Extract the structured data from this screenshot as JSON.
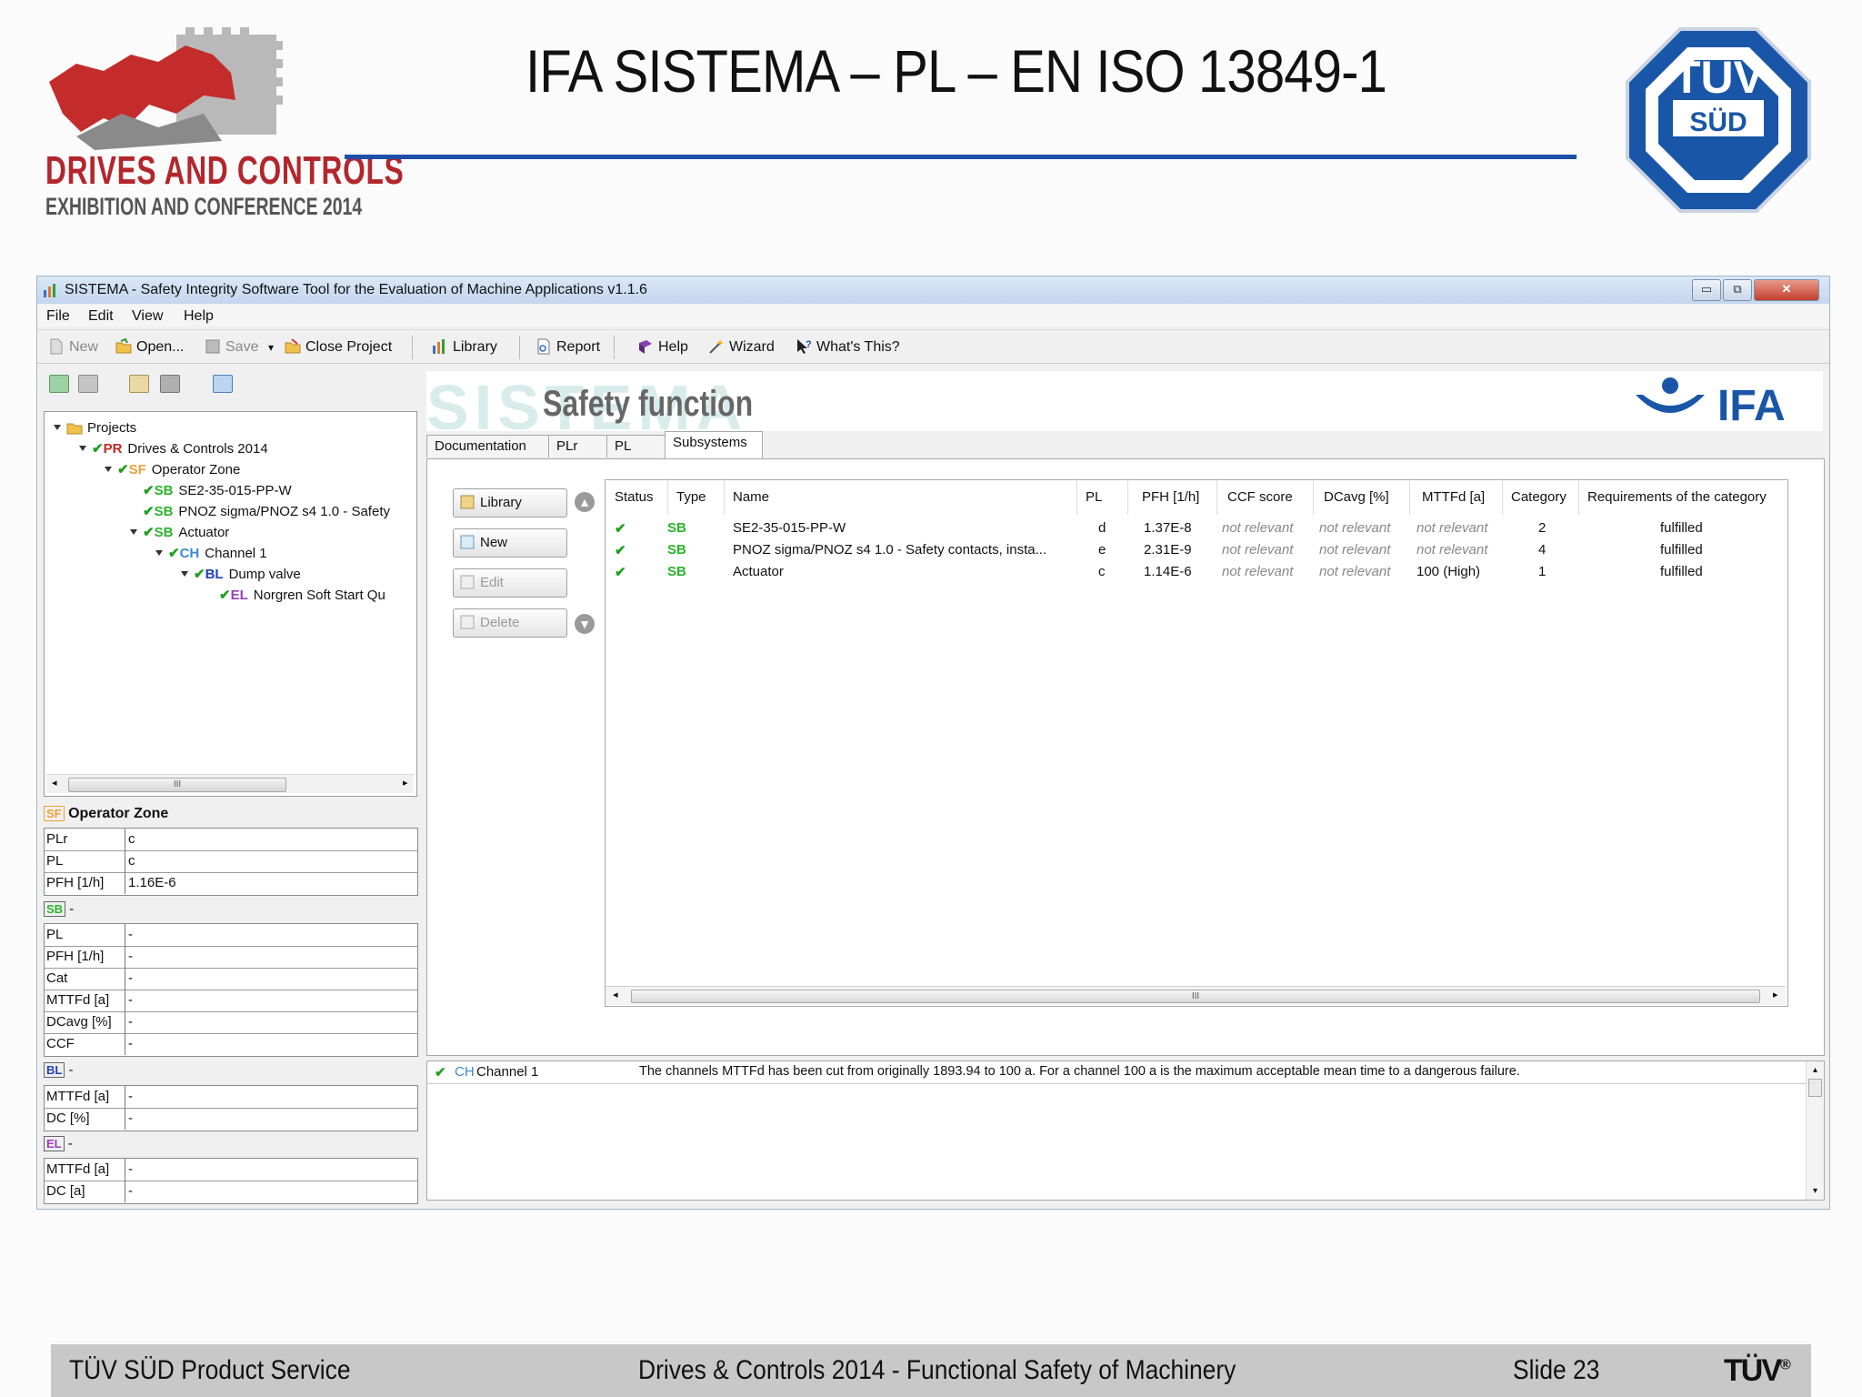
{
  "slide": {
    "title": "IFA SISTEMA – PL – EN ISO 13849-1",
    "logo_dc": {
      "line1": "DRIVES AND CONTROLS",
      "line2": "EXHIBITION AND CONFERENCE 2014"
    },
    "logo_tuv": {
      "top": "TÜV",
      "bottom": "SÜD"
    },
    "footer": {
      "left": "TÜV SÜD Product Service",
      "center": "Drives & Controls 2014 - Functional Safety of Machinery",
      "slide_number": "Slide 23",
      "logo": "TÜV",
      "reg": "®"
    }
  },
  "app": {
    "title": "SISTEMA - Safety Integrity Software Tool for the Evaluation of Machine Applications v1.1.6",
    "window_buttons": {
      "minimize": "▭",
      "restore": "⧉",
      "close": "✕"
    },
    "menu": [
      "File",
      "Edit",
      "View",
      "Help"
    ],
    "toolbar": {
      "new": "New",
      "open": "Open...",
      "save": "Save",
      "save_arrow": "▾",
      "close_project": "Close Project",
      "library": "Library",
      "report": "Report",
      "help": "Help",
      "wizard": "Wizard",
      "whats_this": "What's This?"
    },
    "tree": {
      "root": "Projects",
      "items": [
        {
          "tag": "PR",
          "label": "Drives & Controls 2014"
        },
        {
          "tag": "SF",
          "label": "Operator Zone"
        },
        {
          "tag": "SB",
          "label": "SE2-35-015-PP-W"
        },
        {
          "tag": "SB",
          "label": "PNOZ sigma/PNOZ s4 1.0 - Safety"
        },
        {
          "tag": "SB",
          "label": "Actuator"
        },
        {
          "tag": "CH",
          "label": "Channel 1"
        },
        {
          "tag": "BL",
          "label": "Dump valve"
        },
        {
          "tag": "EL",
          "label": "Norgren Soft Start Qu"
        }
      ],
      "scroll_grip": "III"
    },
    "properties": {
      "sf_header": {
        "tag": "SF",
        "label": "Operator Zone"
      },
      "sf_rows": [
        {
          "key": "PLr",
          "value": "c"
        },
        {
          "key": "PL",
          "value": "c"
        },
        {
          "key": "PFH [1/h]",
          "value": "1.16E-6"
        }
      ],
      "sb_header": {
        "tag": "SB",
        "label": "-"
      },
      "sb_rows": [
        {
          "key": "PL",
          "value": "-"
        },
        {
          "key": "PFH [1/h]",
          "value": "-"
        },
        {
          "key": "Cat",
          "value": "-"
        },
        {
          "key": "MTTFd [a]",
          "value": "-"
        },
        {
          "key": "DCavg [%]",
          "value": "-"
        },
        {
          "key": "CCF",
          "value": "-"
        }
      ],
      "bl_header": {
        "tag": "BL",
        "label": "-"
      },
      "bl_rows": [
        {
          "key": "MTTFd [a]",
          "value": "-"
        },
        {
          "key": "DC [%]",
          "value": "-"
        }
      ],
      "el_header": {
        "tag": "EL",
        "label": "-"
      },
      "el_rows": [
        {
          "key": "MTTFd [a]",
          "value": "-"
        },
        {
          "key": "DC [a]",
          "value": "-"
        }
      ]
    },
    "main": {
      "watermark": "SISTEMA",
      "heading": "Safety function",
      "ifa_logo": "IFA",
      "tabs": [
        "Documentation",
        "PLr",
        "PL",
        "Subsystems"
      ],
      "active_tab": "Subsystems",
      "buttons": {
        "library": "Library",
        "new": "New",
        "edit": "Edit",
        "delete": "Delete"
      },
      "grid": {
        "columns": [
          "Status",
          "Type",
          "Name",
          "PL",
          "PFH [1/h]",
          "CCF score",
          "DCavg [%]",
          "MTTFd [a]",
          "Category",
          "Requirements of the category"
        ],
        "rows": [
          {
            "status": "✔",
            "type": "SB",
            "name": "SE2-35-015-PP-W",
            "pl": "d",
            "pfh": "1.37E-8",
            "ccf": "not relevant",
            "dcavg": "not relevant",
            "mttfd": "not relevant",
            "category": "2",
            "req": "fulfilled"
          },
          {
            "status": "✔",
            "type": "SB",
            "name": "PNOZ sigma/PNOZ s4 1.0 - Safety contacts, insta...",
            "pl": "e",
            "pfh": "2.31E-9",
            "ccf": "not relevant",
            "dcavg": "not relevant",
            "mttfd": "not relevant",
            "category": "4",
            "req": "fulfilled"
          },
          {
            "status": "✔",
            "type": "SB",
            "name": "Actuator",
            "pl": "c",
            "pfh": "1.14E-6",
            "ccf": "not relevant",
            "dcavg": "not relevant",
            "mttfd": "100 (High)",
            "category": "1",
            "req": "fulfilled"
          }
        ],
        "scroll_grip": "III"
      },
      "message": {
        "status": "✔",
        "tag": "CH",
        "source": "Channel 1",
        "text": "The channels MTTFd has been cut from originally 1893.94 to 100 a. For a channel 100 a is the maximum acceptable mean time to a dangerous failure."
      }
    }
  },
  "colors": {
    "accent_blue": "#1e4fa8",
    "check_green": "#1f9e1f",
    "dc_red": "#b3262c",
    "tuv_blue": "#1a56a8"
  },
  "icons": [
    "new-icon",
    "open-icon",
    "save-icon",
    "close-project-icon",
    "library-icon",
    "report-icon",
    "help-icon",
    "wizard-icon",
    "whats-this-icon",
    "folder-icon",
    "check-icon"
  ]
}
